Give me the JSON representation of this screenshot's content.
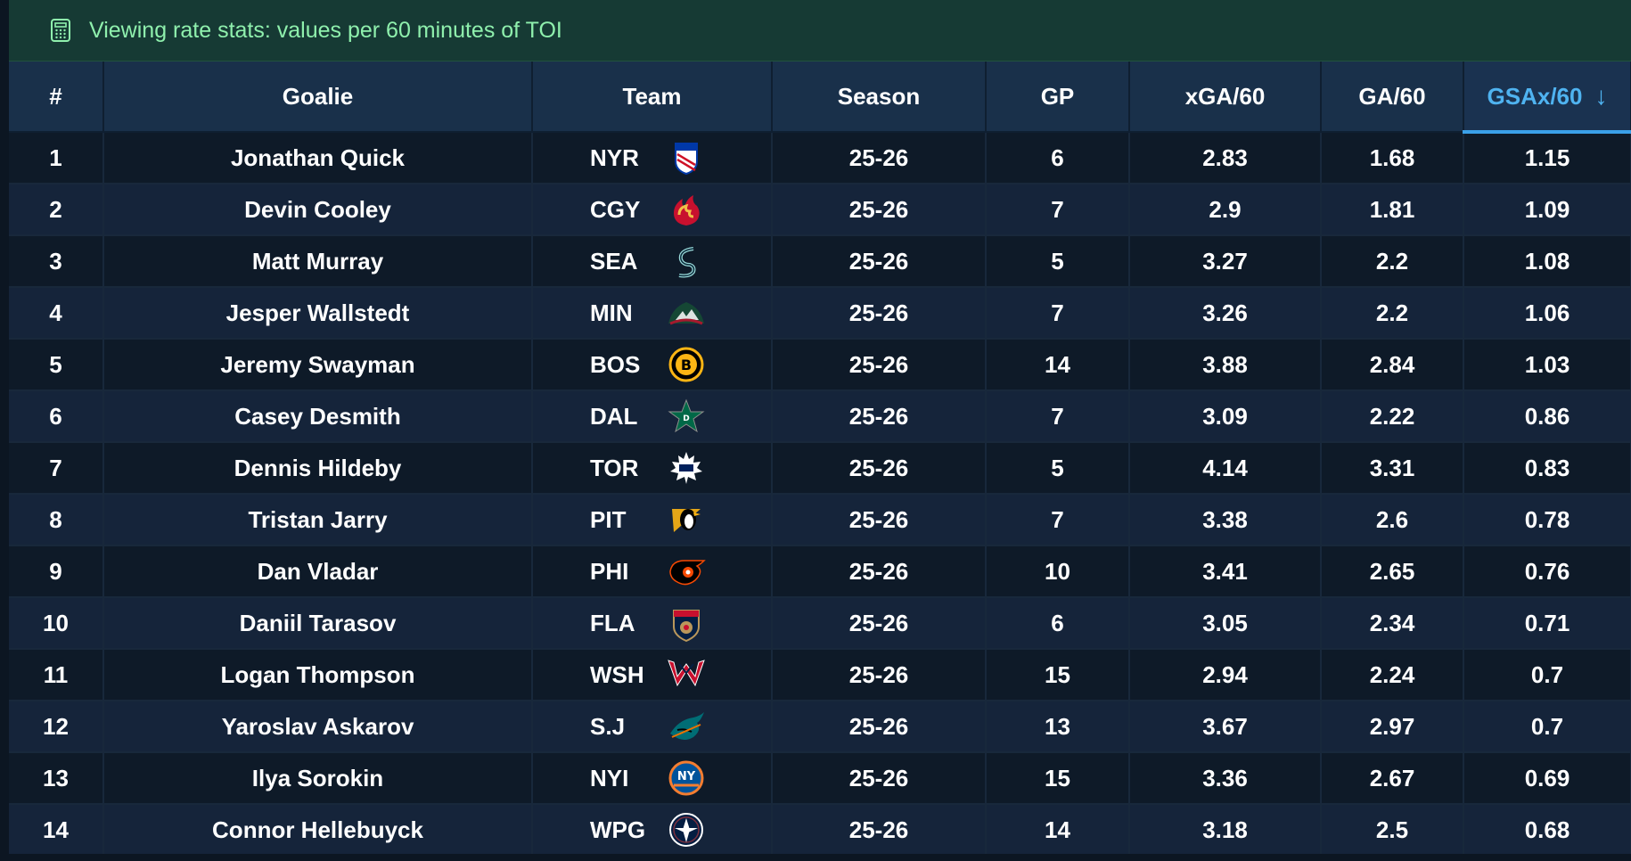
{
  "banner": {
    "icon": "calculator-icon",
    "text": "Viewing rate stats: values per 60 minutes of TOI"
  },
  "columns": [
    {
      "key": "rank",
      "label": "#"
    },
    {
      "key": "goalie",
      "label": "Goalie"
    },
    {
      "key": "team",
      "label": "Team"
    },
    {
      "key": "season",
      "label": "Season"
    },
    {
      "key": "gp",
      "label": "GP"
    },
    {
      "key": "xga60",
      "label": "xGA/60"
    },
    {
      "key": "ga60",
      "label": "GA/60"
    },
    {
      "key": "gsax60",
      "label": "GSAx/60",
      "sort_arrow": "↓"
    }
  ],
  "colors": {
    "banner_bg": "#163a34",
    "banner_text": "#8ff0ad",
    "header_bg": "#19304a",
    "sorted_accent": "#4fb3f0"
  },
  "rows": [
    {
      "rank": "1",
      "goalie": "Jonathan Quick",
      "team": "NYR",
      "logo": "rangers-logo-icon",
      "season": "25-26",
      "gp": "6",
      "xga60": "2.83",
      "ga60": "1.68",
      "gsax60": "1.15"
    },
    {
      "rank": "2",
      "goalie": "Devin Cooley",
      "team": "CGY",
      "logo": "flames-logo-icon",
      "season": "25-26",
      "gp": "7",
      "xga60": "2.9",
      "ga60": "1.81",
      "gsax60": "1.09"
    },
    {
      "rank": "3",
      "goalie": "Matt Murray",
      "team": "SEA",
      "logo": "kraken-logo-icon",
      "season": "25-26",
      "gp": "5",
      "xga60": "3.27",
      "ga60": "2.2",
      "gsax60": "1.08"
    },
    {
      "rank": "4",
      "goalie": "Jesper Wallstedt",
      "team": "MIN",
      "logo": "wild-logo-icon",
      "season": "25-26",
      "gp": "7",
      "xga60": "3.26",
      "ga60": "2.2",
      "gsax60": "1.06"
    },
    {
      "rank": "5",
      "goalie": "Jeremy Swayman",
      "team": "BOS",
      "logo": "bruins-logo-icon",
      "season": "25-26",
      "gp": "14",
      "xga60": "3.88",
      "ga60": "2.84",
      "gsax60": "1.03"
    },
    {
      "rank": "6",
      "goalie": "Casey Desmith",
      "team": "DAL",
      "logo": "stars-logo-icon",
      "season": "25-26",
      "gp": "7",
      "xga60": "3.09",
      "ga60": "2.22",
      "gsax60": "0.86"
    },
    {
      "rank": "7",
      "goalie": "Dennis Hildeby",
      "team": "TOR",
      "logo": "maple-leafs-logo-icon",
      "season": "25-26",
      "gp": "5",
      "xga60": "4.14",
      "ga60": "3.31",
      "gsax60": "0.83"
    },
    {
      "rank": "8",
      "goalie": "Tristan Jarry",
      "team": "PIT",
      "logo": "penguins-logo-icon",
      "season": "25-26",
      "gp": "7",
      "xga60": "3.38",
      "ga60": "2.6",
      "gsax60": "0.78"
    },
    {
      "rank": "9",
      "goalie": "Dan Vladar",
      "team": "PHI",
      "logo": "flyers-logo-icon",
      "season": "25-26",
      "gp": "10",
      "xga60": "3.41",
      "ga60": "2.65",
      "gsax60": "0.76"
    },
    {
      "rank": "10",
      "goalie": "Daniil Tarasov",
      "team": "FLA",
      "logo": "panthers-logo-icon",
      "season": "25-26",
      "gp": "6",
      "xga60": "3.05",
      "ga60": "2.34",
      "gsax60": "0.71"
    },
    {
      "rank": "11",
      "goalie": "Logan Thompson",
      "team": "WSH",
      "logo": "capitals-logo-icon",
      "season": "25-26",
      "gp": "15",
      "xga60": "2.94",
      "ga60": "2.24",
      "gsax60": "0.7"
    },
    {
      "rank": "12",
      "goalie": "Yaroslav Askarov",
      "team": "S.J",
      "logo": "sharks-logo-icon",
      "season": "25-26",
      "gp": "13",
      "xga60": "3.67",
      "ga60": "2.97",
      "gsax60": "0.7"
    },
    {
      "rank": "13",
      "goalie": "Ilya Sorokin",
      "team": "NYI",
      "logo": "islanders-logo-icon",
      "season": "25-26",
      "gp": "15",
      "xga60": "3.36",
      "ga60": "2.67",
      "gsax60": "0.69"
    },
    {
      "rank": "14",
      "goalie": "Connor Hellebuyck",
      "team": "WPG",
      "logo": "jets-logo-icon",
      "season": "25-26",
      "gp": "14",
      "xga60": "3.18",
      "ga60": "2.5",
      "gsax60": "0.68"
    }
  ]
}
